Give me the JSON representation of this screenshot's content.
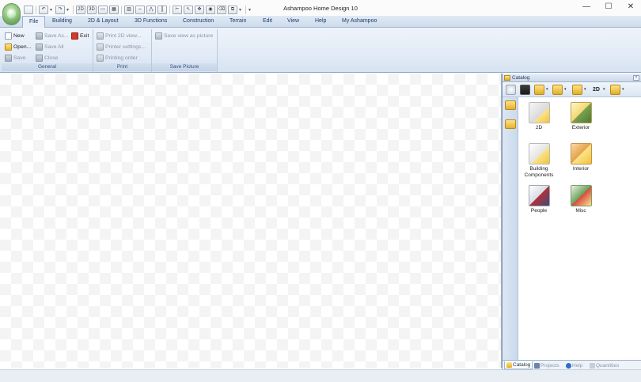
{
  "window": {
    "title": "Ashampoo Home Design 10",
    "controls": {
      "minimize": "—",
      "maximize": "☐",
      "close": "✕"
    }
  },
  "quick_access": [
    "new-icon",
    "undo-icon",
    "redo-icon",
    "view-2d-icon",
    "view-3d-icon",
    "wall-icon",
    "window-icon",
    "door-icon",
    "stairs-icon",
    "roof-icon",
    "select-icon",
    "dimension-icon",
    "camera-icon",
    "eraser-icon",
    "copy-icon",
    "customize-icon"
  ],
  "tabs": [
    {
      "label": "File",
      "active": true
    },
    {
      "label": "Building"
    },
    {
      "label": "2D & Layout"
    },
    {
      "label": "3D Functions"
    },
    {
      "label": "Construction"
    },
    {
      "label": "Terrain"
    },
    {
      "label": "Edit"
    },
    {
      "label": "View"
    },
    {
      "label": "Help"
    },
    {
      "label": "My Ashampoo"
    }
  ],
  "ribbon": {
    "general": {
      "label": "General",
      "new": "New",
      "open": "Open...",
      "save": "Save",
      "save_as": "Save As...",
      "save_all": "Save All",
      "close": "Close",
      "exit": "Exit"
    },
    "print": {
      "label": "Print",
      "print_2d": "Print 2D view...",
      "printer_settings": "Printer settings...",
      "printing_order": "Printing order"
    },
    "save_picture": {
      "label": "Save Picture",
      "save_view": "Save view as picture"
    }
  },
  "catalog": {
    "title": "Catalog",
    "items": [
      {
        "label": "2D",
        "icon": "2d-symbols-icon"
      },
      {
        "label": "Exterior",
        "icon": "exterior-icon"
      },
      {
        "label": "Building Components",
        "icon": "building-components-icon"
      },
      {
        "label": "Interior",
        "icon": "interior-icon"
      },
      {
        "label": "People",
        "icon": "people-icon"
      },
      {
        "label": "Misc",
        "icon": "misc-icon"
      }
    ],
    "bottom_tabs": [
      {
        "label": "Catalog",
        "active": true
      },
      {
        "label": "Projects"
      },
      {
        "label": "Help"
      },
      {
        "label": "Quantities"
      }
    ]
  },
  "colors": {
    "ribbon": "#e2ebf6",
    "tab_text": "#1d3c63",
    "accent_folder": "#f2c33a"
  }
}
